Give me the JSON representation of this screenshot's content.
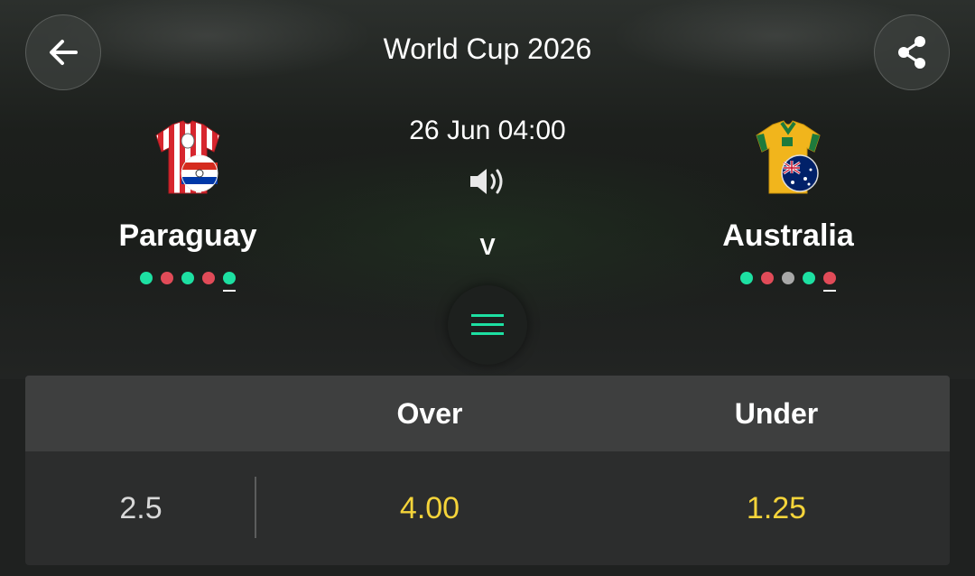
{
  "header": {
    "title": "World Cup 2026",
    "back_icon": "arrow-left-icon",
    "share_icon": "share-icon"
  },
  "match": {
    "datetime": "26 Jun 04:00",
    "sound_icon": "speaker-icon",
    "versus": "V",
    "menu_icon": "menu-icon"
  },
  "home": {
    "name": "Paraguay",
    "shirt_icon": "paraguay-shirt-icon",
    "form": [
      "win",
      "loss",
      "win",
      "loss",
      "win"
    ]
  },
  "away": {
    "name": "Australia",
    "shirt_icon": "australia-shirt-icon",
    "form": [
      "win",
      "loss",
      "draw",
      "win",
      "loss"
    ]
  },
  "form_colors": {
    "win": "#1de0a2",
    "loss": "#e14b58",
    "draw": "#a8a8a8"
  },
  "market": {
    "headers": {
      "line": "",
      "over": "Over",
      "under": "Under"
    },
    "rows": [
      {
        "line": "2.5",
        "over": "4.00",
        "under": "1.25"
      }
    ]
  },
  "colors": {
    "accent": "#1de0a2",
    "odds": "#f5d43a",
    "background": "#1f2120"
  }
}
